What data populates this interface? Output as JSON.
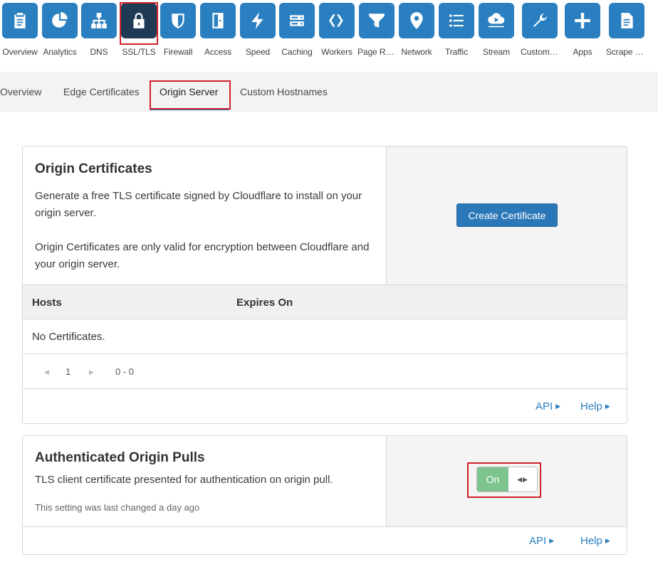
{
  "apps": [
    {
      "name": "app-overview",
      "label": "Overview",
      "icon": "clipboard-icon"
    },
    {
      "name": "app-analytics",
      "label": "Analytics",
      "icon": "pie-chart-icon"
    },
    {
      "name": "app-dns",
      "label": "DNS",
      "icon": "network-tree-icon"
    },
    {
      "name": "app-ssl-tls",
      "label": "SSL/TLS",
      "icon": "lock-icon"
    },
    {
      "name": "app-firewall",
      "label": "Firewall",
      "icon": "shield-icon"
    },
    {
      "name": "app-access",
      "label": "Access",
      "icon": "door-icon"
    },
    {
      "name": "app-speed",
      "label": "Speed",
      "icon": "lightning-icon"
    },
    {
      "name": "app-caching",
      "label": "Caching",
      "icon": "server-icon"
    },
    {
      "name": "app-workers",
      "label": "Workers",
      "icon": "workers-icon"
    },
    {
      "name": "app-page-rules",
      "label": "Page Rules",
      "icon": "filter-icon"
    },
    {
      "name": "app-network",
      "label": "Network",
      "icon": "location-pin-icon"
    },
    {
      "name": "app-traffic",
      "label": "Traffic",
      "icon": "list-icon"
    },
    {
      "name": "app-stream",
      "label": "Stream",
      "icon": "cloud-play-icon"
    },
    {
      "name": "app-custom-pages",
      "label": "Custom Pa...",
      "icon": "wrench-icon"
    },
    {
      "name": "app-apps",
      "label": "Apps",
      "icon": "plus-icon"
    },
    {
      "name": "app-scrape-shield",
      "label": "Scrape Shi...",
      "icon": "document-icon"
    }
  ],
  "active_app": "SSL/TLS",
  "subtabs": [
    {
      "label": "Overview"
    },
    {
      "label": "Edge Certificates"
    },
    {
      "label": "Origin Server"
    },
    {
      "label": "Custom Hostnames"
    }
  ],
  "active_subtab": "Origin Server",
  "origin_certificates": {
    "title": "Origin Certificates",
    "desc1": "Generate a free TLS certificate signed by Cloudflare to install on your origin server.",
    "desc2": "Origin Certificates are only valid for encryption between Cloudflare and your origin server.",
    "button": "Create Certificate",
    "table": {
      "columns": [
        "Hosts",
        "Expires On"
      ],
      "empty_text": "No Certificates."
    },
    "pager": {
      "page": "1",
      "range": "0 - 0"
    },
    "links": {
      "api": "API",
      "help": "Help"
    }
  },
  "authenticated_origin_pulls": {
    "title": "Authenticated Origin Pulls",
    "desc": "TLS client certificate presented for authentication on origin pull.",
    "last_changed": "This setting was last changed a day ago",
    "toggle_label": "On",
    "toggle_state": true,
    "links": {
      "api": "API",
      "help": "Help"
    }
  },
  "colors": {
    "tile": "#2a7fc0",
    "tile_active": "#1f3a55",
    "primary_button": "#2b78b8",
    "toggle_on": "#7dc48f",
    "highlight": "#d0202a"
  }
}
